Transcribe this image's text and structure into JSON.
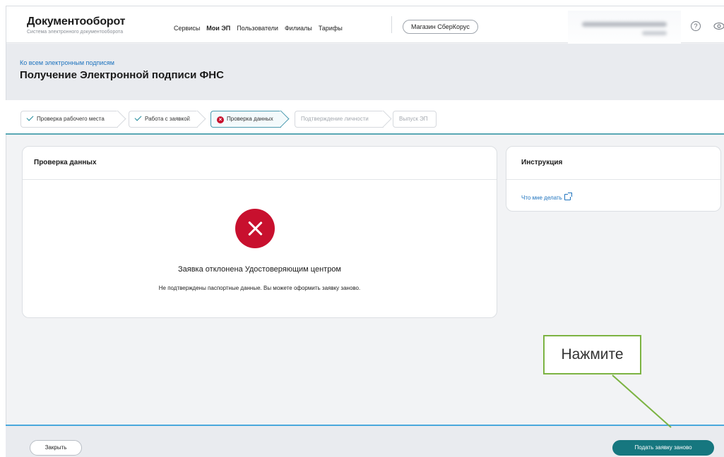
{
  "header": {
    "brand_name": "Документооборот",
    "brand_sub": "Система электронного документооборота",
    "nav": [
      {
        "label": "Сервисы",
        "active": false
      },
      {
        "label": "Мои ЭП",
        "active": true
      },
      {
        "label": "Пользователи",
        "active": false
      },
      {
        "label": "Филиалы",
        "active": false
      },
      {
        "label": "Тарифы",
        "active": false
      }
    ],
    "store_button": "Магазин СберКорус",
    "help_icon": "question-circle-icon",
    "eye_icon": "eye-icon"
  },
  "page": {
    "back_link": "Ко всем электронным подписям",
    "title": "Получение Электронной подписи ФНС"
  },
  "stepper": {
    "steps": [
      {
        "label": "Проверка рабочего места",
        "state": "done"
      },
      {
        "label": "Работа с заявкой",
        "state": "done"
      },
      {
        "label": "Проверка данных",
        "state": "error"
      },
      {
        "label": "Подтверждение личности",
        "state": "todo"
      },
      {
        "label": "Выпуск ЭП",
        "state": "todo"
      }
    ]
  },
  "main_card": {
    "title": "Проверка данных",
    "error_title": "Заявка отклонена Удостоверяющим центром",
    "error_text": "Не подтверждены паспортные данные. Вы можете оформить заявку заново."
  },
  "side_card": {
    "title": "Инструкция",
    "link": "Что мне делать"
  },
  "footer": {
    "close_button": "Закрыть",
    "resubmit_button": "Подать заявку заново"
  },
  "annotation": {
    "label": "Нажмите"
  },
  "colors": {
    "error": "#c8102e",
    "primary": "#16777f",
    "link": "#1e73be",
    "annotation": "#7cb342"
  }
}
